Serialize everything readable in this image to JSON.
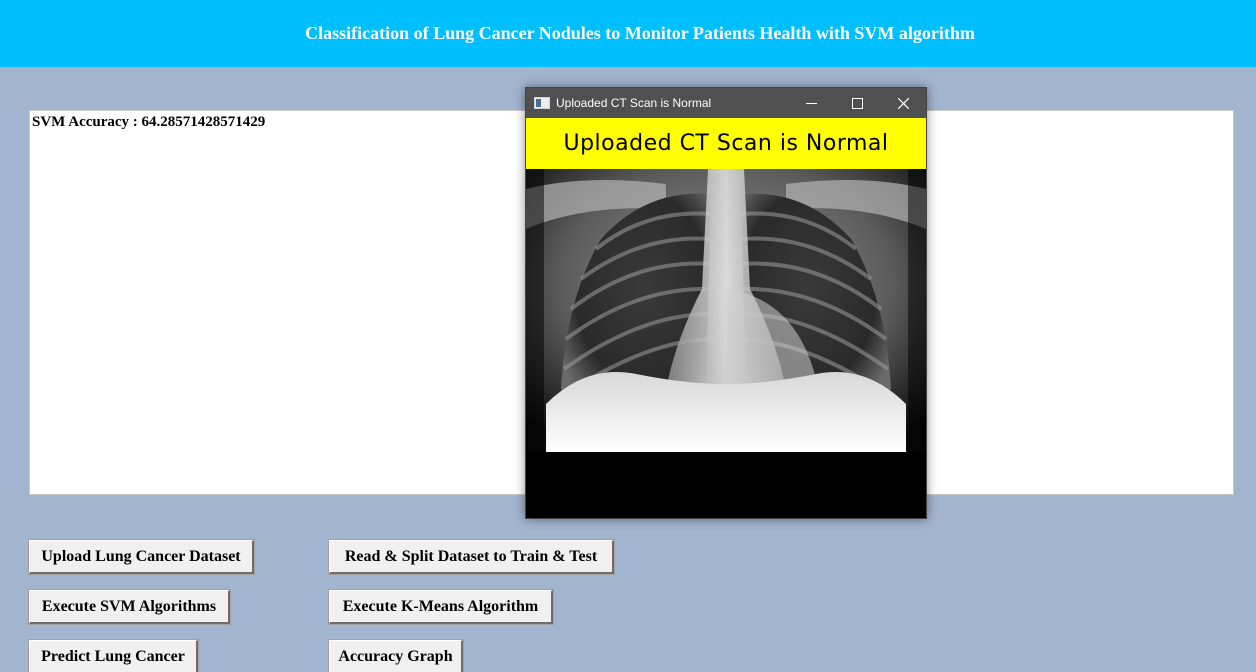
{
  "header": {
    "title": "Classification of Lung Cancer Nodules to Monitor Patients Health with SVM algorithm",
    "background_color": "#00bfff"
  },
  "output": {
    "text": "SVM Accuracy : 64.28571428571429"
  },
  "buttons": {
    "upload": "Upload Lung Cancer Dataset",
    "read_split": "Read & Split Dataset to Train & Test",
    "svm": "Execute SVM Algorithms",
    "kmeans": "Execute K-Means Algorithm",
    "predict": "Predict Lung Cancer",
    "graph": "Accuracy Graph"
  },
  "popup": {
    "window_title": "Uploaded CT Scan is Normal",
    "banner_text": "Uploaded CT Scan is Normal",
    "banner_color": "#ffff00",
    "controls": [
      "minimize-icon",
      "maximize-icon",
      "close-icon"
    ]
  },
  "colors": {
    "page_background": "#a3b4cf"
  }
}
